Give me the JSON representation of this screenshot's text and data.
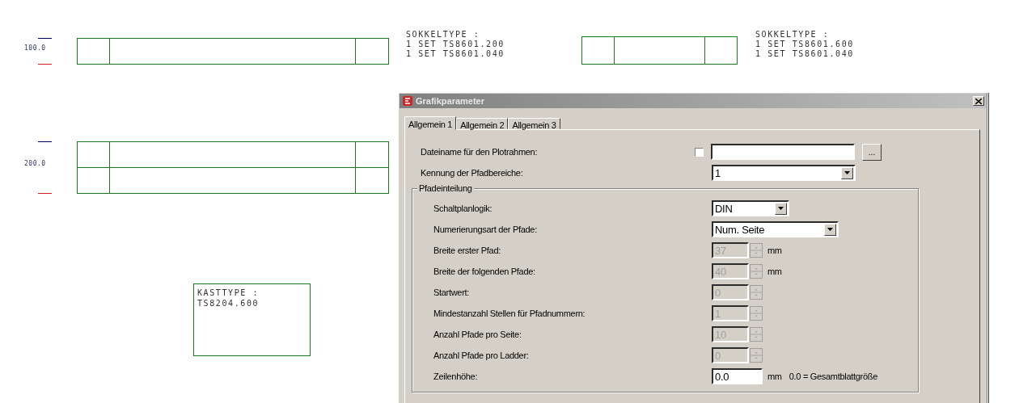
{
  "canvas": {
    "markers": [
      {
        "label": "100.0"
      },
      {
        "label": "200.0"
      }
    ],
    "notes": [
      {
        "lines": [
          "SOKKELTYPE :",
          "1 SET TS8601.200",
          "1 SET TS8601.040"
        ]
      },
      {
        "lines": [
          "SOKKELTYPE :",
          "1 SET TS8601.600",
          "1 SET TS8601.040"
        ]
      }
    ],
    "cabinet_label": {
      "lines": [
        "KASTTYPE :",
        "TS8204.600"
      ]
    }
  },
  "dialog": {
    "title": "Grafikparameter",
    "tabs": [
      {
        "label": "Allgemein 1",
        "selected": true
      },
      {
        "label": "Allgemein 2",
        "selected": false
      },
      {
        "label": "Allgemein 3",
        "selected": false
      }
    ],
    "fields": [
      {
        "kind": "file",
        "label": "Dateiname für den Plotrahmen:",
        "checked": false,
        "button": "..."
      },
      {
        "kind": "combo",
        "label": "Kennung der Pfadbereiche:",
        "value": "1"
      }
    ],
    "group": {
      "title": "Pfadeinteilung",
      "fields": [
        {
          "kind": "combo",
          "label": "Schaltplanlogik:",
          "value": "DIN"
        },
        {
          "kind": "combo",
          "label": "Numerierungsart der Pfade:",
          "value": "Num. Seite"
        },
        {
          "kind": "spin",
          "label": "Breite erster Pfad:",
          "value": "37",
          "disabled": true,
          "unit": "mm"
        },
        {
          "kind": "spin",
          "label": "Breite der folgenden Pfade:",
          "value": "40",
          "disabled": true,
          "unit": "mm"
        },
        {
          "kind": "spin",
          "label": "Startwert:",
          "value": "0",
          "disabled": true
        },
        {
          "kind": "spin",
          "label": "Mindestanzahl Stellen für Pfadnummern:",
          "value": "1",
          "disabled": true
        },
        {
          "kind": "spin",
          "label": "Anzahl Pfade pro Seite:",
          "value": "10",
          "disabled": true
        },
        {
          "kind": "spin",
          "label": "Anzahl Pfade pro Ladder:",
          "value": "0",
          "disabled": true
        },
        {
          "kind": "text",
          "label": "Zeilenhöhe:",
          "value": "0.0",
          "unit": "mm",
          "note": "0.0 = Gesamtblattgröße"
        }
      ]
    }
  }
}
